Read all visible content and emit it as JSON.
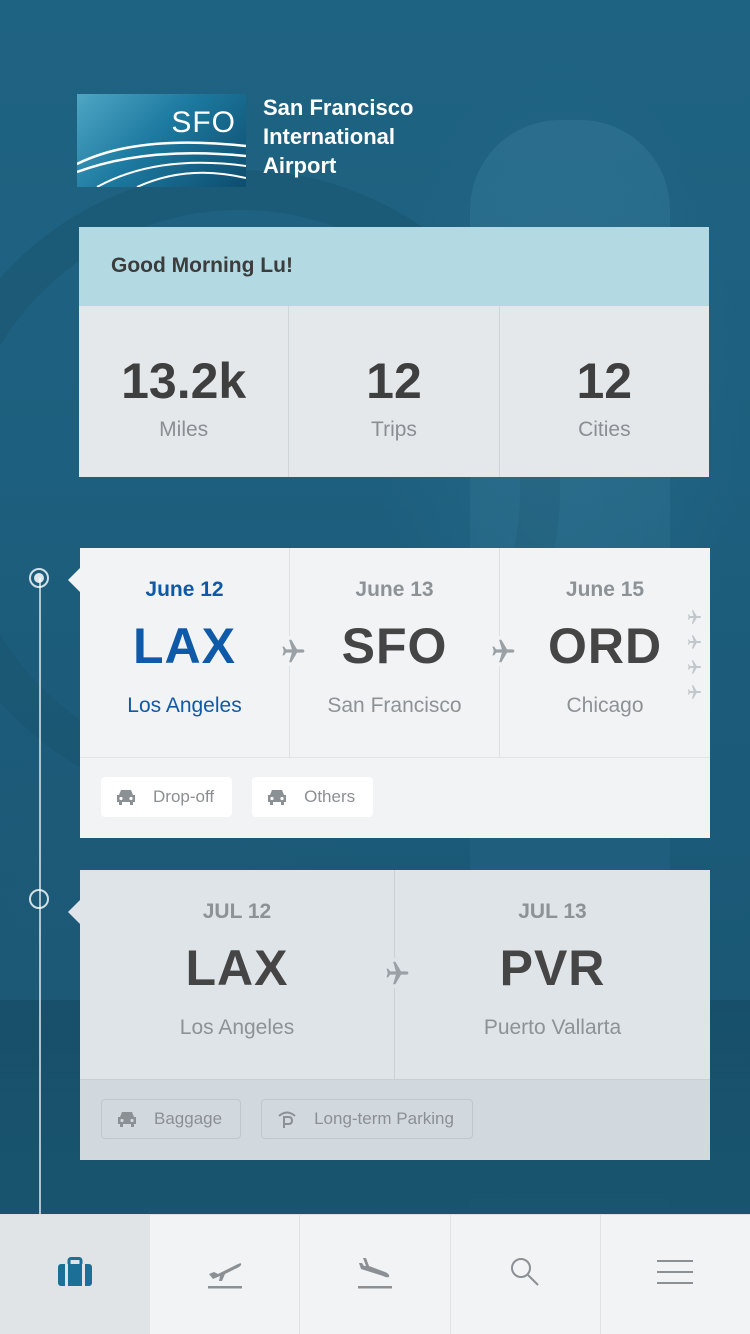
{
  "header": {
    "logo_code": "SFO",
    "airport_name_line1": "San Francisco",
    "airport_name_line2": "International",
    "airport_name_line3": "Airport"
  },
  "greeting": {
    "text": "Good Morning Lu!",
    "stats": [
      {
        "value": "13.2k",
        "label": "Miles"
      },
      {
        "value": "12",
        "label": "Trips"
      },
      {
        "value": "12",
        "label": "Cities"
      }
    ]
  },
  "trips": [
    {
      "legs": [
        {
          "date": "June 12",
          "code": "LAX",
          "city": "Los Angeles",
          "active": true
        },
        {
          "date": "June 13",
          "code": "SFO",
          "city": "San Francisco",
          "active": false
        },
        {
          "date": "June 15",
          "code": "ORD",
          "city": "Chicago",
          "active": false
        }
      ],
      "actions": [
        {
          "icon": "car-icon",
          "label": "Drop-off"
        },
        {
          "icon": "car-icon",
          "label": "Others"
        }
      ]
    },
    {
      "legs": [
        {
          "date": "JUL 12",
          "code": "LAX",
          "city": "Los Angeles",
          "active": false
        },
        {
          "date": "JUL 13",
          "code": "PVR",
          "city": "Puerto Vallarta",
          "active": false
        }
      ],
      "actions": [
        {
          "icon": "car-icon",
          "label": "Baggage"
        },
        {
          "icon": "parking-icon",
          "label": "Long-term Parking"
        }
      ]
    }
  ],
  "tabbar": {
    "items": [
      {
        "icon": "briefcase-icon",
        "active": true
      },
      {
        "icon": "departures-icon",
        "active": false
      },
      {
        "icon": "arrivals-icon",
        "active": false
      },
      {
        "icon": "search-icon",
        "active": false
      },
      {
        "icon": "menu-icon",
        "active": false
      }
    ]
  },
  "colors": {
    "accent": "#0e5aa8",
    "header_bg": "#1d5f7e",
    "greeting_bar": "#b3d9e2",
    "tab_icon_active": "#1c6f96",
    "muted_text": "#8d9296"
  }
}
